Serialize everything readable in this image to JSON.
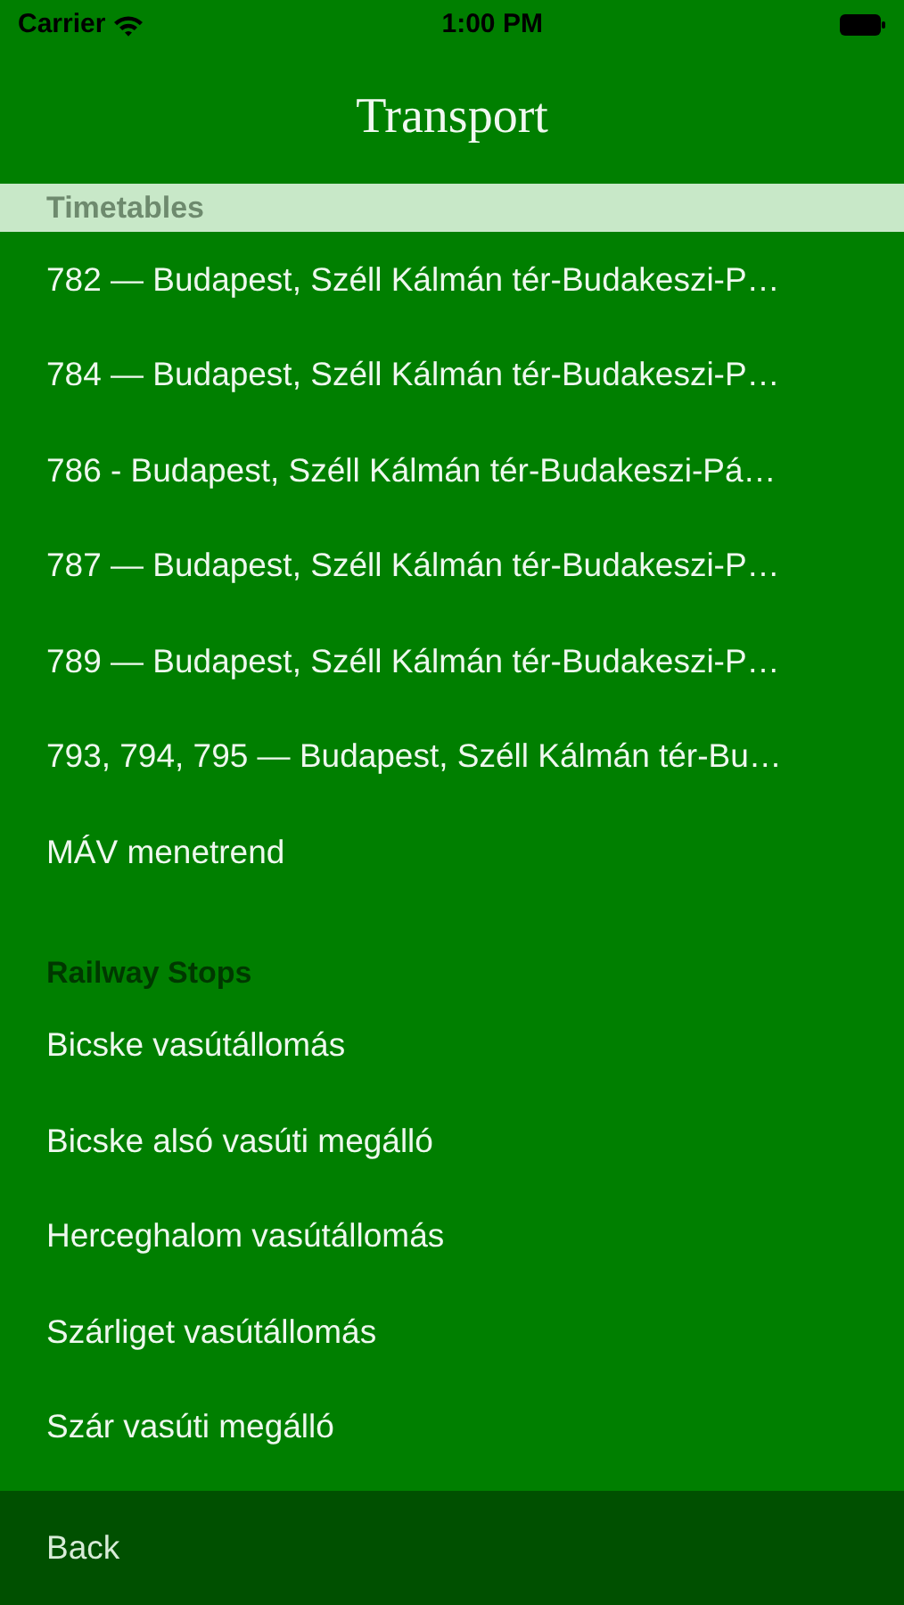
{
  "status_bar": {
    "carrier": "Carrier",
    "time": "1:00 PM"
  },
  "nav": {
    "title": "Transport"
  },
  "sections": [
    {
      "title": "Timetables",
      "pinned": true,
      "items": [
        "782 — Budapest, Széll Kálmán tér-Budakeszi-P…",
        "784 — Budapest, Széll Kálmán tér-Budakeszi-P…",
        "786 - Budapest, Széll Kálmán tér-Budakeszi-Pá…",
        "787 — Budapest, Széll Kálmán tér-Budakeszi-P…",
        "789 — Budapest, Széll Kálmán tér-Budakeszi-P…",
        "793, 794, 795 — Budapest, Széll Kálmán tér-Bu…",
        "MÁV menetrend"
      ]
    },
    {
      "title": "Railway Stops",
      "pinned": false,
      "items": [
        "Bicske vasútállomás",
        "Bicske alsó vasúti megálló",
        "Herceghalom vasútállomás",
        "Szárliget vasútállomás",
        "Szár vasúti megálló"
      ]
    }
  ],
  "toolbar": {
    "back": "Back"
  }
}
